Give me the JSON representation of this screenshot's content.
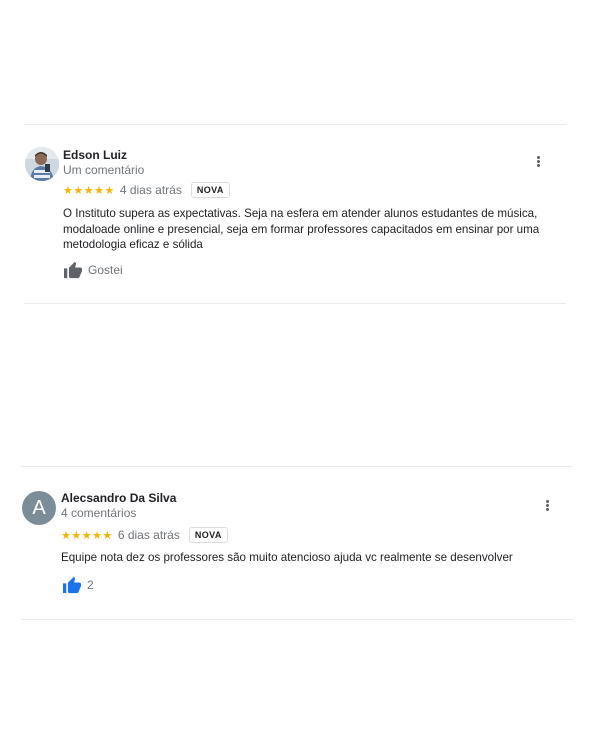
{
  "reviews": [
    {
      "author": "Edson Luiz",
      "author_meta": "Um comentário",
      "stars": "★★★★★",
      "date": "4 dias atrás",
      "badge": "NOVA",
      "text": "O Instituto supera as expectativas. Seja na esfera em atender alunos estudantes de música, modaloade online e presencial, seja em formar professores capacitados em ensinar por uma metodologia eficaz e sólida",
      "like_label": "Gostei",
      "like_icon": "thumbs-up-icon",
      "like_color": "#5f6368"
    },
    {
      "author": "Alecsandro Da Silva",
      "author_meta": "4 comentários",
      "avatar_letter": "A",
      "avatar_color": "#7b8d99",
      "stars": "★★★★★",
      "date": "6 dias atrás",
      "badge": "NOVA",
      "text": "Equipe nota dez os professores são muito atencioso ajuda vc realmente se desenvolver",
      "like_label": "2",
      "like_icon": "thumbs-up-icon",
      "like_color": "#1a73e8"
    }
  ],
  "colors": {
    "star": "#f4b400",
    "divider": "#e8eaed",
    "secondary_text": "#70757a"
  }
}
